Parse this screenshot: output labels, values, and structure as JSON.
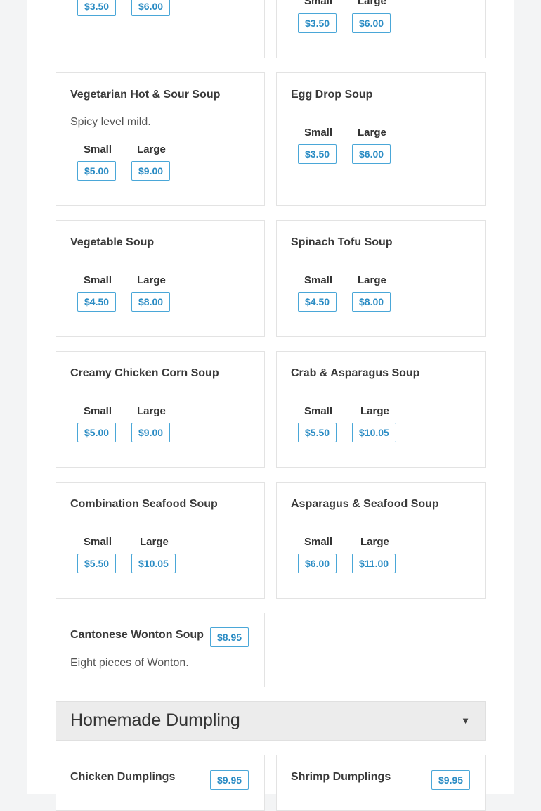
{
  "menu": {
    "soups": [
      {
        "name": "",
        "sizes": [
          {
            "label": "",
            "price": "$3.50"
          },
          {
            "label": "",
            "price": "$6.00"
          }
        ]
      },
      {
        "name": "",
        "sizes": [
          {
            "label": "Small",
            "price": "$3.50"
          },
          {
            "label": "Large",
            "price": "$6.00"
          }
        ]
      },
      {
        "name": "Vegetarian Hot & Sour Soup",
        "description": "Spicy level mild.",
        "sizes": [
          {
            "label": "Small",
            "price": "$5.00"
          },
          {
            "label": "Large",
            "price": "$9.00"
          }
        ]
      },
      {
        "name": "Egg Drop Soup",
        "sizes": [
          {
            "label": "Small",
            "price": "$3.50"
          },
          {
            "label": "Large",
            "price": "$6.00"
          }
        ]
      },
      {
        "name": "Vegetable Soup",
        "sizes": [
          {
            "label": "Small",
            "price": "$4.50"
          },
          {
            "label": "Large",
            "price": "$8.00"
          }
        ]
      },
      {
        "name": "Spinach Tofu Soup",
        "sizes": [
          {
            "label": "Small",
            "price": "$4.50"
          },
          {
            "label": "Large",
            "price": "$8.00"
          }
        ]
      },
      {
        "name": "Creamy Chicken Corn Soup",
        "sizes": [
          {
            "label": "Small",
            "price": "$5.00"
          },
          {
            "label": "Large",
            "price": "$9.00"
          }
        ]
      },
      {
        "name": "Crab & Asparagus Soup",
        "sizes": [
          {
            "label": "Small",
            "price": "$5.50"
          },
          {
            "label": "Large",
            "price": "$10.05"
          }
        ]
      },
      {
        "name": "Combination Seafood Soup",
        "sizes": [
          {
            "label": "Small",
            "price": "$5.50"
          },
          {
            "label": "Large",
            "price": "$10.05"
          }
        ]
      },
      {
        "name": "Asparagus & Seafood Soup",
        "sizes": [
          {
            "label": "Small",
            "price": "$6.00"
          },
          {
            "label": "Large",
            "price": "$11.00"
          }
        ]
      },
      {
        "name": "Cantonese Wonton Soup",
        "description": "Eight pieces of Wonton.",
        "price": "$8.95"
      }
    ],
    "dumpling_section": {
      "title": "Homemade Dumpling",
      "chevron_icon": "chevron-down-icon",
      "items": [
        {
          "name": "Chicken Dumplings",
          "price": "$9.95"
        },
        {
          "name": "Shrimp Dumplings",
          "price": "$9.95"
        }
      ]
    }
  },
  "colors": {
    "accent": "#2b8cc4",
    "accent_border": "#4aa7d8",
    "page_bg": "#f3f4f5",
    "card_border": "#e3e3e3",
    "section_bg": "#ececec"
  }
}
